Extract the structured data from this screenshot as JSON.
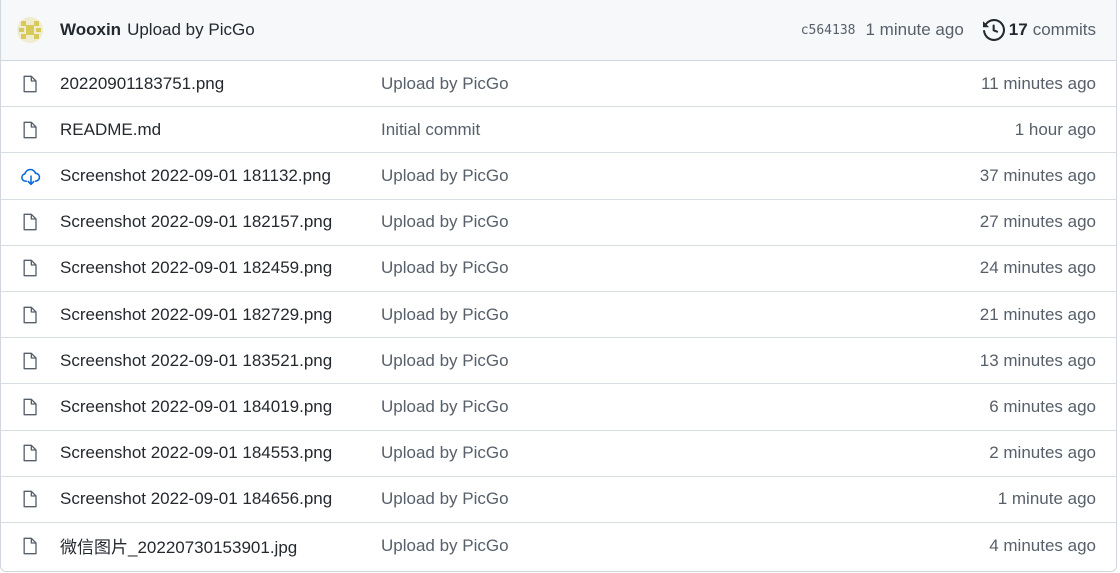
{
  "header": {
    "author": "Wooxin",
    "message": "Upload by PicGo",
    "sha": "c564138",
    "time": "1 minute ago",
    "commits_count": "17",
    "commits_label": "commits"
  },
  "colors": {
    "cloud_icon": "#0969da",
    "file_icon": "#57606a",
    "avatar": "#d9c85a"
  },
  "files": [
    {
      "icon": "file-icon",
      "name": "20220901183751.png",
      "message": "Upload by PicGo",
      "time": "11 minutes ago"
    },
    {
      "icon": "file-icon",
      "name": "README.md",
      "message": "Initial commit",
      "time": "1 hour ago"
    },
    {
      "icon": "cloud-download-icon",
      "name": "Screenshot 2022-09-01 181132.png",
      "message": "Upload by PicGo",
      "time": "37 minutes ago"
    },
    {
      "icon": "file-icon",
      "name": "Screenshot 2022-09-01 182157.png",
      "message": "Upload by PicGo",
      "time": "27 minutes ago"
    },
    {
      "icon": "file-icon",
      "name": "Screenshot 2022-09-01 182459.png",
      "message": "Upload by PicGo",
      "time": "24 minutes ago"
    },
    {
      "icon": "file-icon",
      "name": "Screenshot 2022-09-01 182729.png",
      "message": "Upload by PicGo",
      "time": "21 minutes ago"
    },
    {
      "icon": "file-icon",
      "name": "Screenshot 2022-09-01 183521.png",
      "message": "Upload by PicGo",
      "time": "13 minutes ago"
    },
    {
      "icon": "file-icon",
      "name": "Screenshot 2022-09-01 184019.png",
      "message": "Upload by PicGo",
      "time": "6 minutes ago"
    },
    {
      "icon": "file-icon",
      "name": "Screenshot 2022-09-01 184553.png",
      "message": "Upload by PicGo",
      "time": "2 minutes ago"
    },
    {
      "icon": "file-icon",
      "name": "Screenshot 2022-09-01 184656.png",
      "message": "Upload by PicGo",
      "time": "1 minute ago"
    },
    {
      "icon": "file-icon",
      "name": "微信图片_20220730153901.jpg",
      "message": "Upload by PicGo",
      "time": "4 minutes ago"
    }
  ]
}
